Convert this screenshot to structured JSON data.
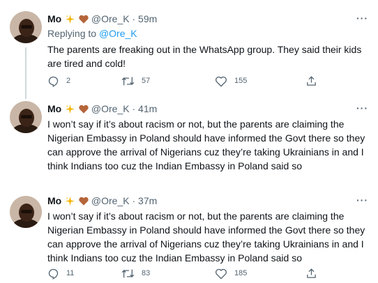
{
  "tweets": [
    {
      "name": "Mo",
      "handle": "@Ore_K",
      "sep": "·",
      "time": "59m",
      "more": "···",
      "replying_label": "Replying to",
      "replying_handle": "@Ore_K",
      "text": "The parents are freaking out in the WhatsApp group. They said their kids are tired and cold!",
      "replies": "2",
      "retweets": "57",
      "likes": "155"
    },
    {
      "name": "Mo",
      "handle": "@Ore_K",
      "sep": "·",
      "time": "41m",
      "more": "···",
      "text": "I won’t say if it’s about racism or not, but the parents are claiming the Nigerian Embassy in Poland should have informed the Govt there so they can approve the arrival of Nigerians cuz they’re taking Ukrainians in and I think Indians too cuz the Indian Embassy in Poland said so"
    },
    {
      "name": "Mo",
      "handle": "@Ore_K",
      "sep": "·",
      "time": "37m",
      "more": "···",
      "text": "I won’t say if it’s about racism or not, but the parents are claiming the Nigerian Embassy in Poland should have informed the Govt there so they can approve the arrival of Nigerians cuz they’re taking Ukrainians in and I think Indians too cuz the Indian Embassy in Poland said so",
      "replies": "11",
      "retweets": "83",
      "likes": "185"
    }
  ],
  "icons": {
    "name_emoji": [
      "sparkles-icon",
      "brown-heart-icon"
    ],
    "actions": [
      "reply-icon",
      "retweet-icon",
      "like-icon",
      "share-icon"
    ]
  },
  "colors": {
    "text": "#0f1419",
    "secondary": "#536471",
    "link": "#1d9bf0",
    "sparkle": "#f4b400",
    "heart": "#b5653a"
  }
}
